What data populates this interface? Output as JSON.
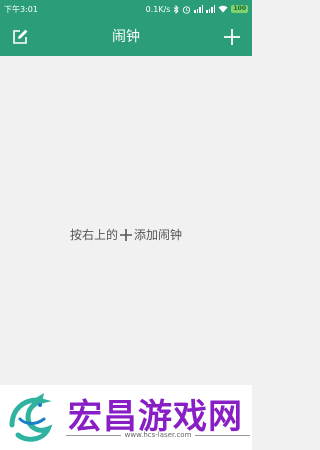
{
  "status_bar": {
    "time": "下午3:01",
    "net_speed": "0.1K/s",
    "battery": "100",
    "icons": [
      "bluetooth-icon",
      "alarm-icon",
      "signal-icon",
      "wifi-icon",
      "battery-icon"
    ]
  },
  "toolbar": {
    "title": "闹钟",
    "left_icon": "edit-icon",
    "right_icon": "add-icon"
  },
  "empty_state": {
    "text_before": "按右上的",
    "icon": "plus-icon",
    "text_after": "添加闹钟"
  },
  "watermark": {
    "title": "宏昌游戏网",
    "url": "www.hcs-laser.com"
  },
  "colors": {
    "accent": "#2b9e79",
    "background": "#f1f1f1",
    "watermark_text": "#8a1ec5"
  }
}
